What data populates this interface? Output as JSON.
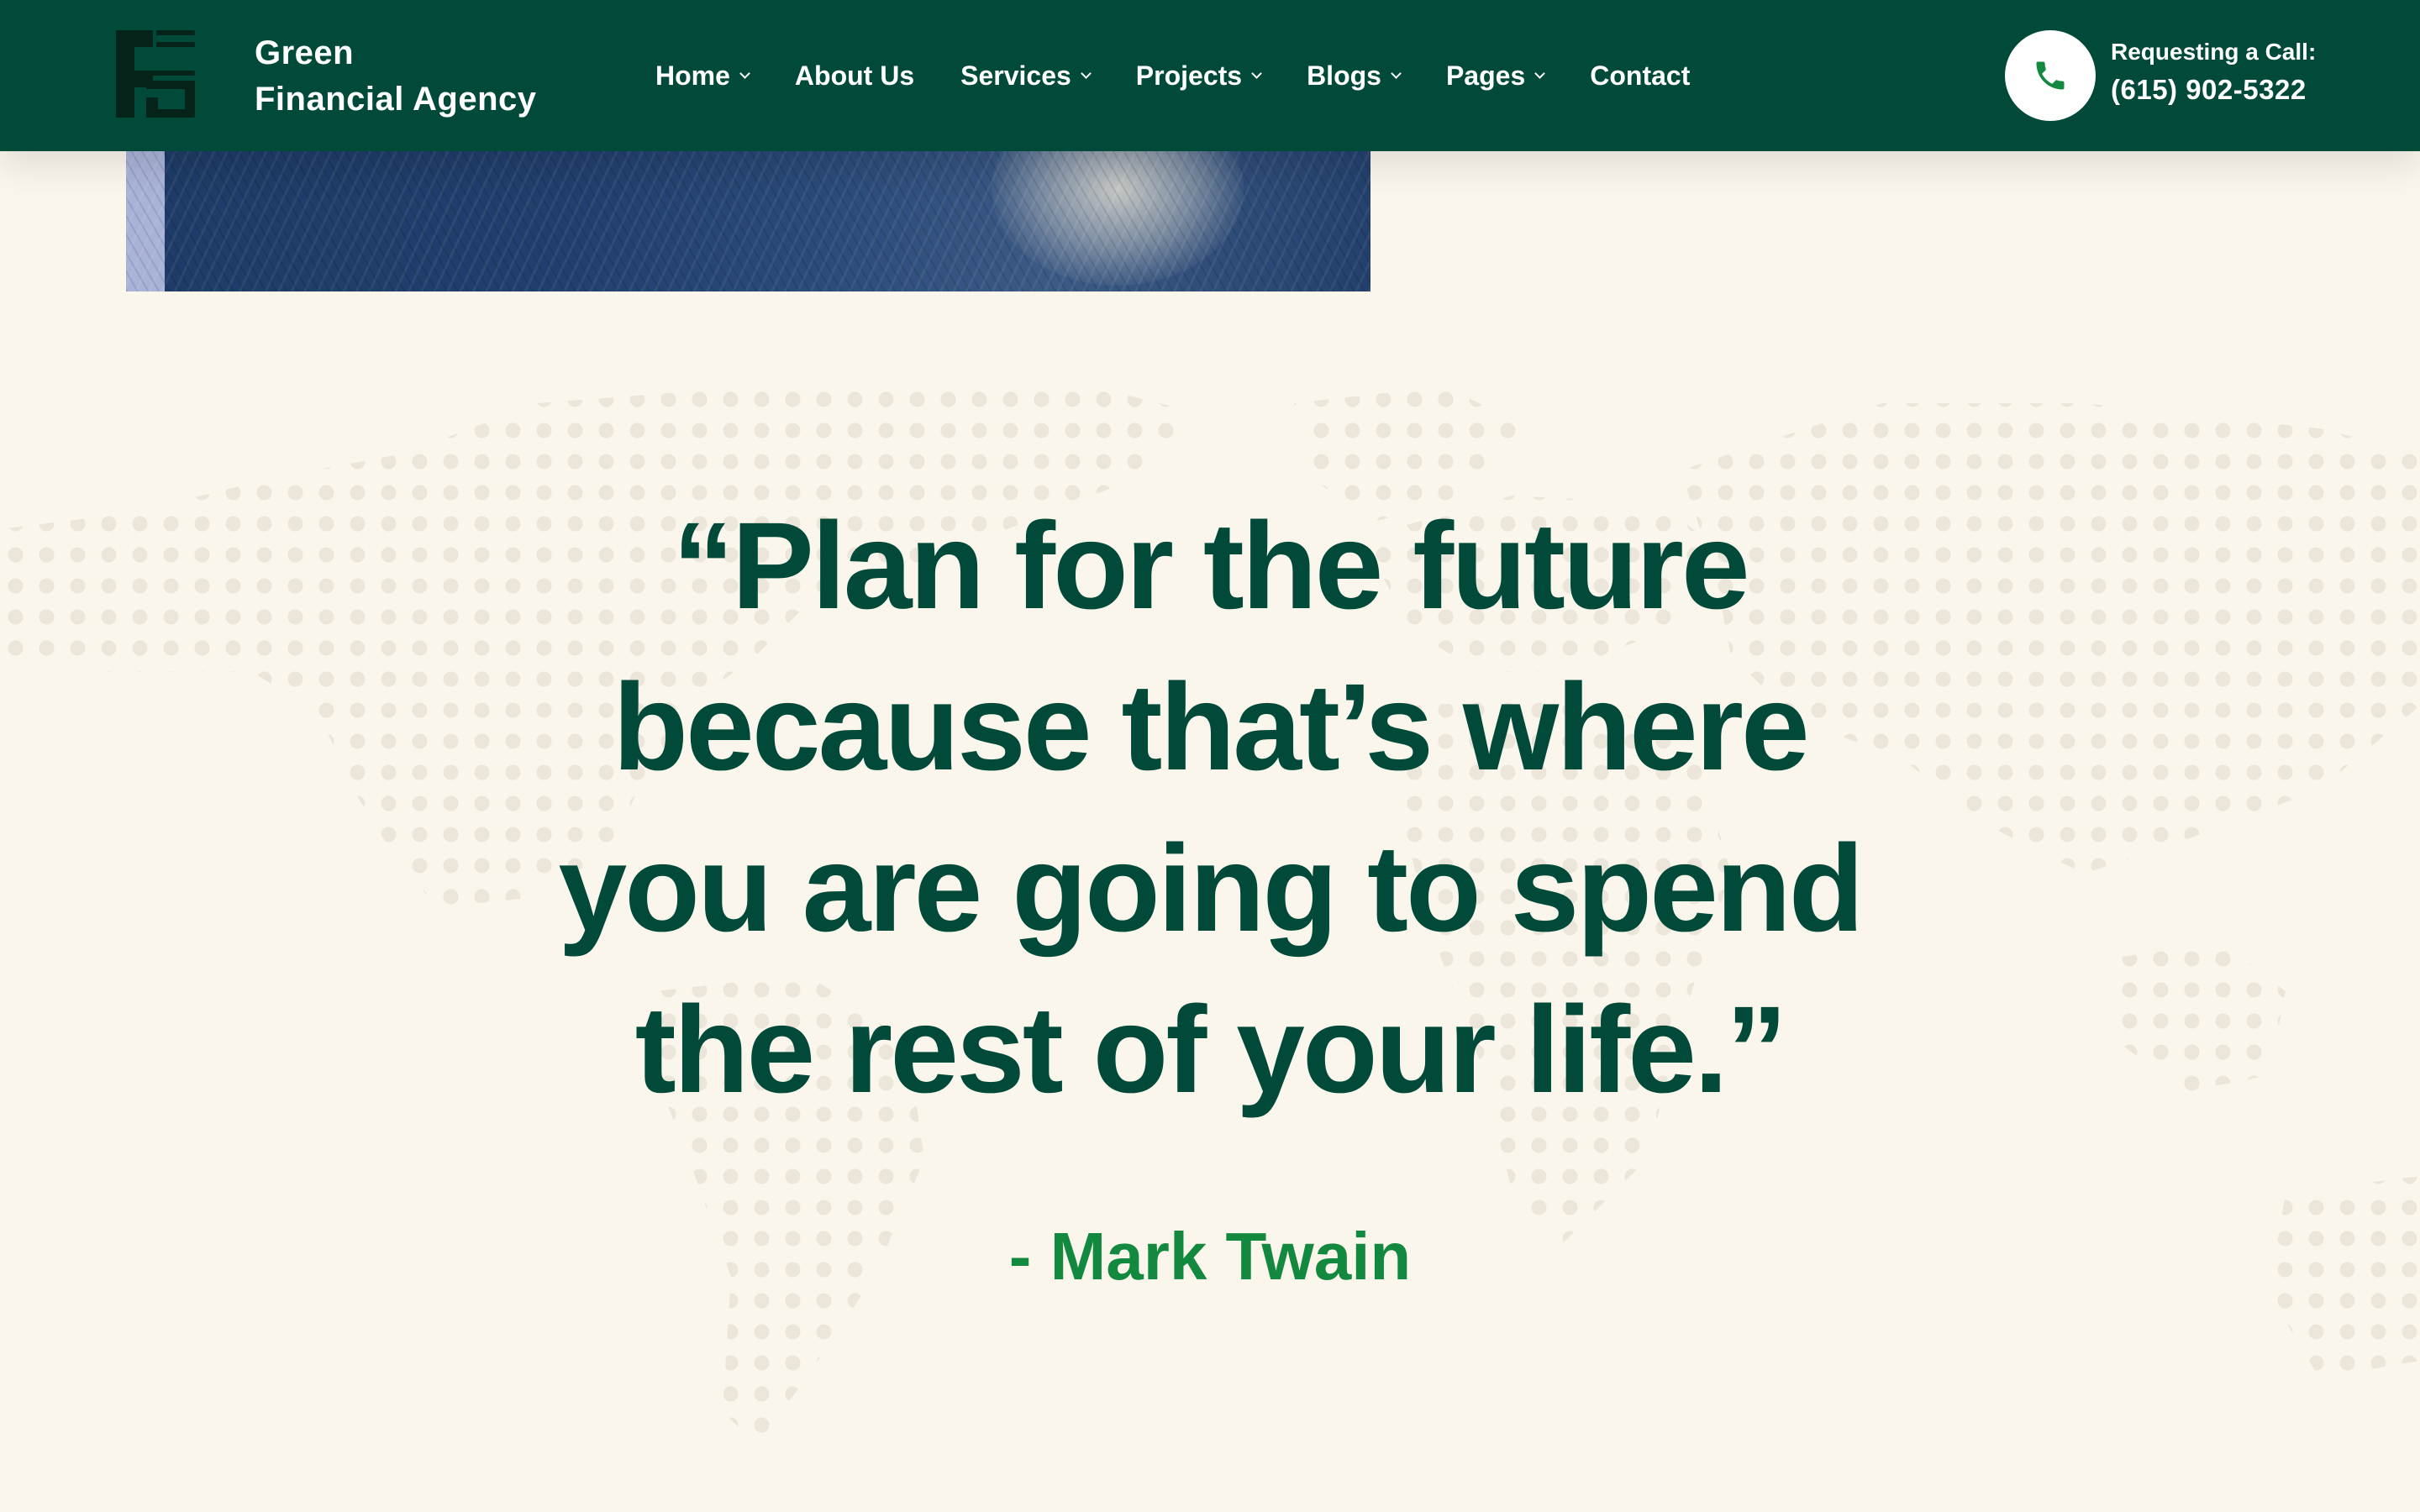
{
  "brand": {
    "name_line1": "Green",
    "name_line2": "Financial Agency",
    "logo_icon": "gfa-logo-icon"
  },
  "nav": {
    "items": [
      {
        "label": "Home",
        "has_dropdown": true
      },
      {
        "label": "About Us",
        "has_dropdown": false
      },
      {
        "label": "Services",
        "has_dropdown": true
      },
      {
        "label": "Projects",
        "has_dropdown": true
      },
      {
        "label": "Blogs",
        "has_dropdown": true
      },
      {
        "label": "Pages",
        "has_dropdown": true
      },
      {
        "label": "Contact",
        "has_dropdown": false
      }
    ]
  },
  "call": {
    "label": "Requesting a Call:",
    "number": "(615) 902-5322",
    "icon": "phone-icon"
  },
  "quote": {
    "lines": [
      "“Plan for the future",
      "because that’s where",
      "you are going to spend",
      "the rest of your life.”"
    ],
    "author": "- Mark Twain"
  },
  "colors": {
    "header_bg": "#014a3a",
    "page_bg": "#faf6ec",
    "quote_text": "#014a3a",
    "author_text": "#12893e",
    "phone_icon": "#12893e",
    "map_dots": "#ebe6d9"
  }
}
